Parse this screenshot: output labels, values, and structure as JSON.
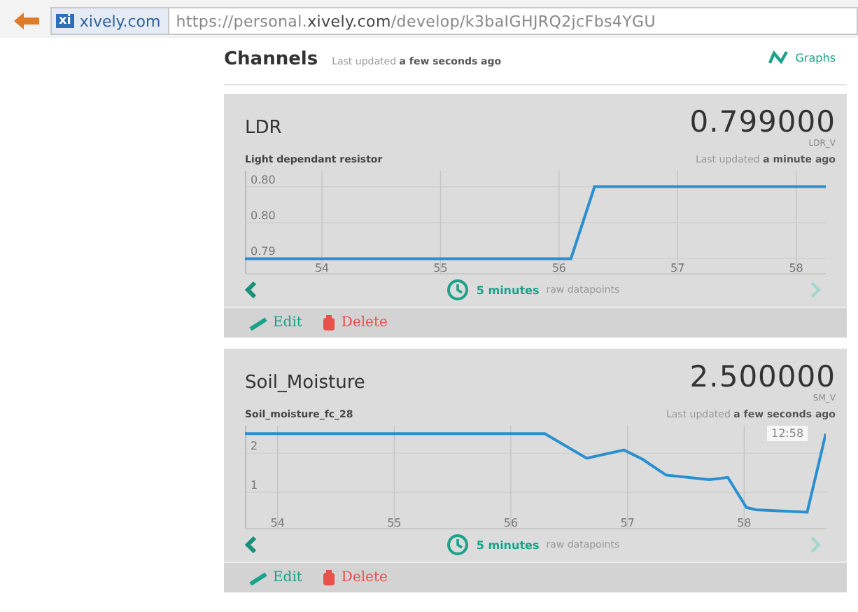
{
  "browser": {
    "site_badge": "xi",
    "site_name": "xively.com",
    "url_prefix": "https://personal.",
    "url_host": "xively.com",
    "url_path": "/develop/k3baIGHJRQ2jcFbs4YGU"
  },
  "header": {
    "title": "Channels",
    "updated_label": "Last updated",
    "updated_value": "a few seconds ago",
    "graphs_link": "Graphs"
  },
  "channels": [
    {
      "name": "LDR",
      "value": "0.799000",
      "unit": "LDR_V",
      "description": "Light dependant resistor",
      "updated_label": "Last updated",
      "updated_value": "a minute ago",
      "range": "5 minutes",
      "range_note": "raw datapoints",
      "edit": "Edit",
      "delete": "Delete",
      "chart_data": {
        "type": "line",
        "grid": true,
        "xlim": [
          53.35,
          58.25
        ],
        "ylim": [
          0.7878,
          0.8022
        ],
        "xticks": [
          54,
          55,
          56,
          57,
          58
        ],
        "yticks": [
          {
            "value": 0.8,
            "label": "0.80"
          },
          {
            "value": 0.795,
            "label": "0.80"
          },
          {
            "value": 0.79,
            "label": "0.79"
          }
        ],
        "x": [
          53.35,
          56.1,
          56.3,
          58.25
        ],
        "series": [
          {
            "color": "#2a8fd0",
            "values": [
              0.79,
              0.79,
              0.8,
              0.8
            ]
          }
        ]
      }
    },
    {
      "name": "Soil_Moisture",
      "value": "2.500000",
      "unit": "SM_V",
      "description": "Soil_moisture_fc_28",
      "updated_label": "Last updated",
      "updated_value": "a few seconds ago",
      "range": "5 minutes",
      "range_note": "raw datapoints",
      "edit": "Edit",
      "delete": "Delete",
      "tooltip": "12:58",
      "chart_data": {
        "type": "line",
        "grid": true,
        "xlim": [
          53.72,
          58.7
        ],
        "ylim": [
          0.05,
          2.7
        ],
        "xticks": [
          54,
          55,
          56,
          57,
          58
        ],
        "yticks": [
          {
            "value": 2,
            "label": "2"
          },
          {
            "value": 1,
            "label": "1"
          }
        ],
        "x": [
          53.72,
          56.29,
          56.65,
          56.97,
          57.13,
          57.33,
          57.7,
          57.86,
          58.02,
          58.1,
          58.54,
          58.7
        ],
        "series": [
          {
            "color": "#2a8fd0",
            "values": [
              2.5,
              2.5,
              1.87,
              2.08,
              1.84,
              1.44,
              1.32,
              1.38,
              0.61,
              0.55,
              0.49,
              2.5
            ]
          }
        ]
      }
    }
  ]
}
